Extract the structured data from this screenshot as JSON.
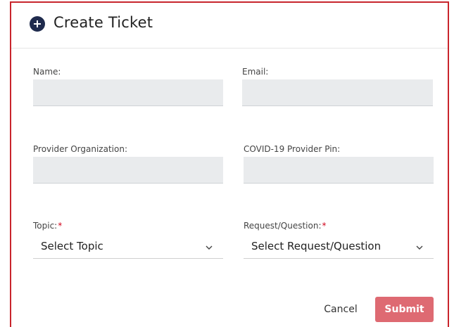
{
  "dialog": {
    "title": "Create Ticket",
    "header_icon": "plus-circle-icon"
  },
  "form": {
    "name": {
      "label": "Name:",
      "value": ""
    },
    "email": {
      "label": "Email:",
      "value": ""
    },
    "provider_org": {
      "label": "Provider Organization:",
      "value": ""
    },
    "provider_pin": {
      "label": "COVID-19 Provider Pin:",
      "value": ""
    },
    "topic": {
      "label": "Topic:",
      "required_marker": "*",
      "selected": "Select Topic"
    },
    "request": {
      "label": "Request/Question:",
      "required_marker": "*",
      "selected": "Select Request/Question"
    }
  },
  "actions": {
    "cancel_label": "Cancel",
    "submit_label": "Submit"
  },
  "colors": {
    "border": "#c8252c",
    "header_icon": "#1f2b4d",
    "submit_bg": "#de6a72",
    "required": "#d0021b"
  }
}
